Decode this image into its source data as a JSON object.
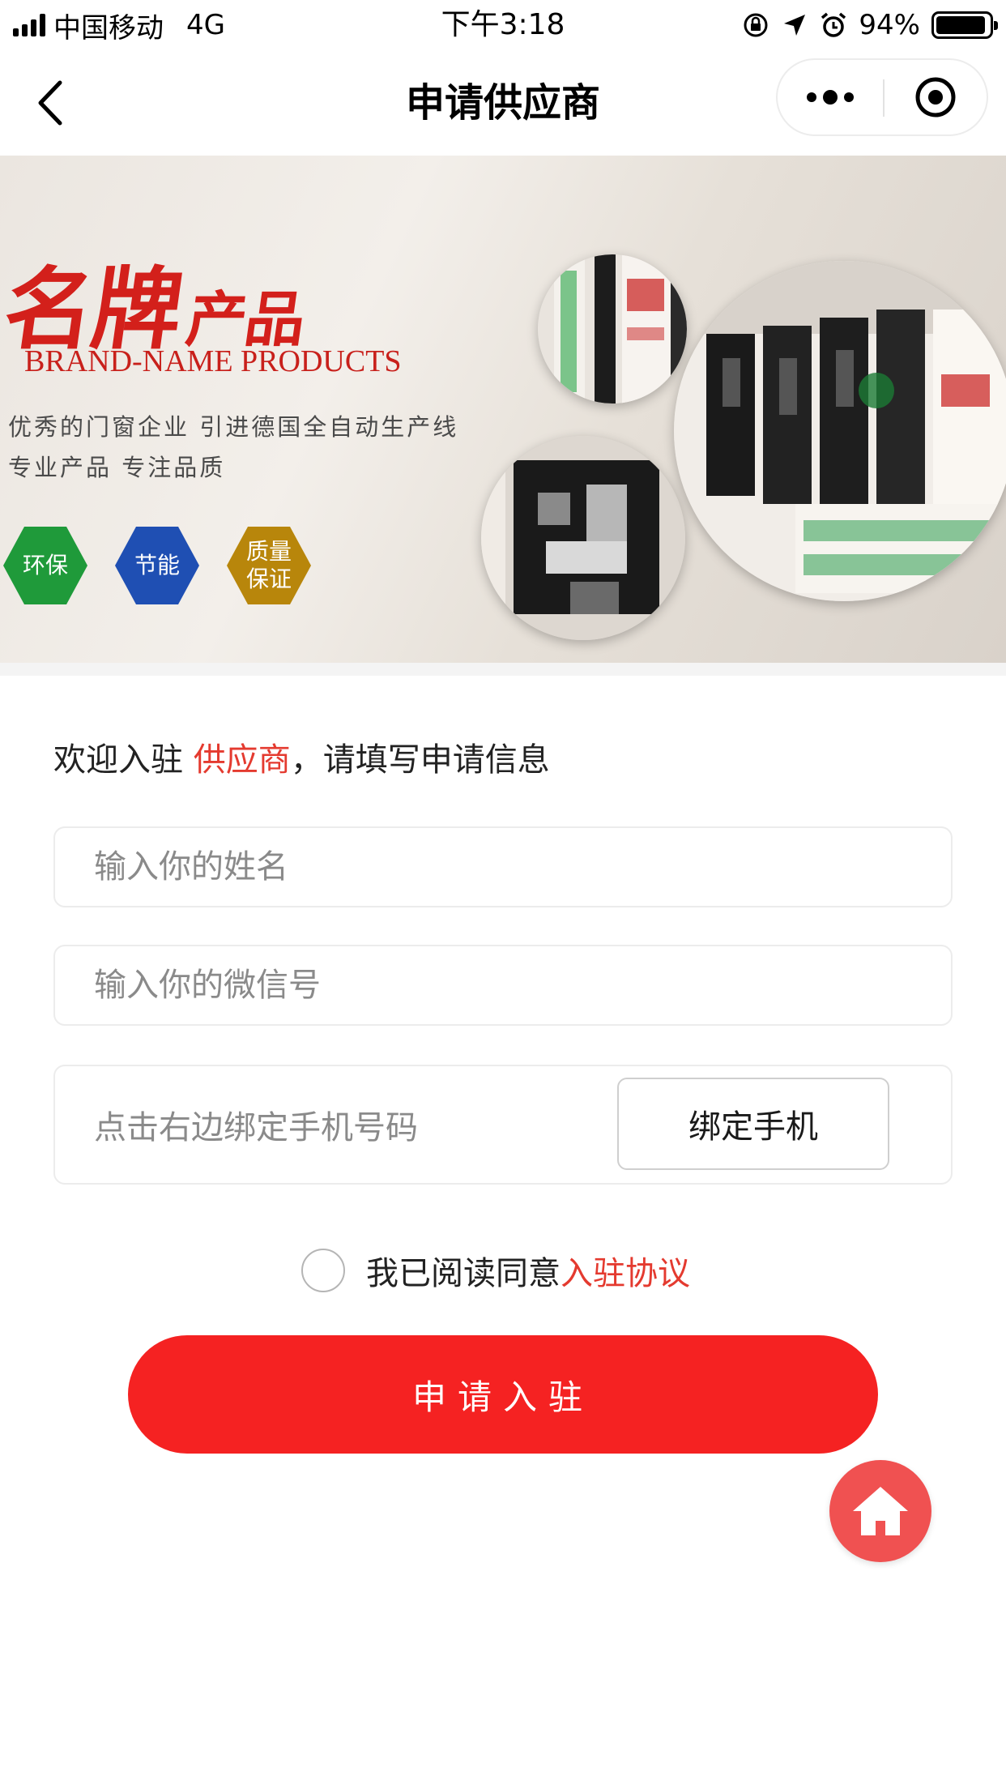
{
  "status_bar": {
    "carrier": "中国移动",
    "network": "4G",
    "time": "下午3:18",
    "battery": "94%",
    "battery_level": 0.94
  },
  "nav": {
    "title": "申请供应商"
  },
  "banner": {
    "headline_main": "名牌",
    "headline_small": "产品",
    "subtitle": "BRAND-NAME PRODUCTS",
    "line1": "优秀的门窗企业  引进德国全自动生产线",
    "line2": "专业产品  专注品质",
    "badges": [
      {
        "label_line1": "环保",
        "label_line2": "",
        "color": "#1f9a3a"
      },
      {
        "label_line1": "节能",
        "label_line2": "",
        "color": "#1f4fb3"
      },
      {
        "label_line1": "质量",
        "label_line2": "保证",
        "color": "#b8860b"
      }
    ],
    "accent_color": "#d3201b"
  },
  "form": {
    "welcome_prefix": "欢迎入驻 ",
    "welcome_highlight": "供应商",
    "welcome_suffix": "，请填写申请信息",
    "name_placeholder": "输入你的姓名",
    "wechat_placeholder": "输入你的微信号",
    "phone_placeholder": "点击右边绑定手机号码",
    "bind_button": "绑定手机",
    "agree_text": "我已阅读同意",
    "agree_link": "入驻协议",
    "submit": "申请入驻"
  },
  "colors": {
    "primary": "#f52222",
    "highlight": "#e43a2f",
    "fab": "#f05151"
  },
  "icons": {
    "back": "chevron-left-icon",
    "more": "more-dots-icon",
    "close": "target-circle-icon",
    "home": "home-icon"
  }
}
